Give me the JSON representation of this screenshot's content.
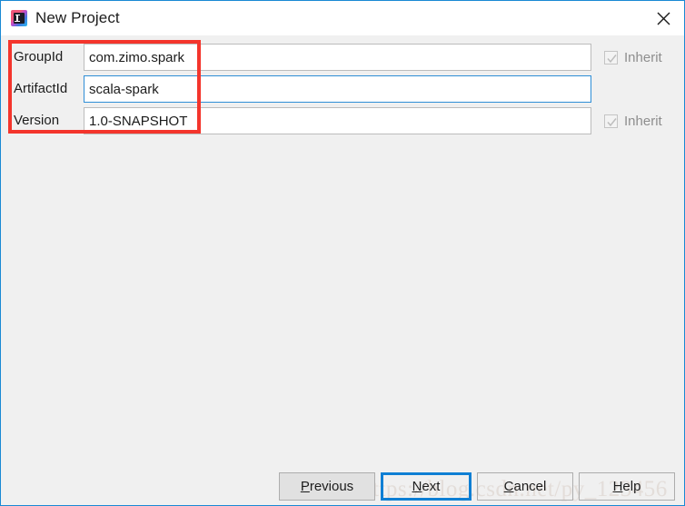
{
  "window": {
    "title": "New Project",
    "app_icon": "intellij-idea-icon",
    "close_icon": "close-icon",
    "border_color": "#1a89d4",
    "titlebar_bg": "#ffffff",
    "body_bg": "#f0f0f0"
  },
  "form": {
    "rows": [
      {
        "label": "GroupId",
        "value": "com.zimo.spark",
        "focused": false,
        "has_inherit": true,
        "inherit_label": "Inherit",
        "inherit_checked": true,
        "inherit_enabled": false
      },
      {
        "label": "ArtifactId",
        "value": "scala-spark",
        "focused": true,
        "has_inherit": false,
        "inherit_label": "",
        "inherit_checked": false,
        "inherit_enabled": false
      },
      {
        "label": "Version",
        "value": "1.0-SNAPSHOT",
        "focused": false,
        "has_inherit": true,
        "inherit_label": "Inherit",
        "inherit_checked": true,
        "inherit_enabled": false
      }
    ]
  },
  "annotation": {
    "name": "red-highlight-rectangle",
    "color": "#f4352c"
  },
  "watermark": {
    "text": "https://blog.csdn.net/py_123456",
    "color": "#e3ddd9"
  },
  "buttons": {
    "previous": {
      "mnemonic": "P",
      "rest": "revious",
      "focused": false
    },
    "next": {
      "mnemonic": "N",
      "rest": "ext",
      "focused": true
    },
    "cancel": {
      "mnemonic": "C",
      "rest": "ancel",
      "focused": false
    },
    "help": {
      "mnemonic": "H",
      "rest": "elp",
      "focused": false
    }
  }
}
